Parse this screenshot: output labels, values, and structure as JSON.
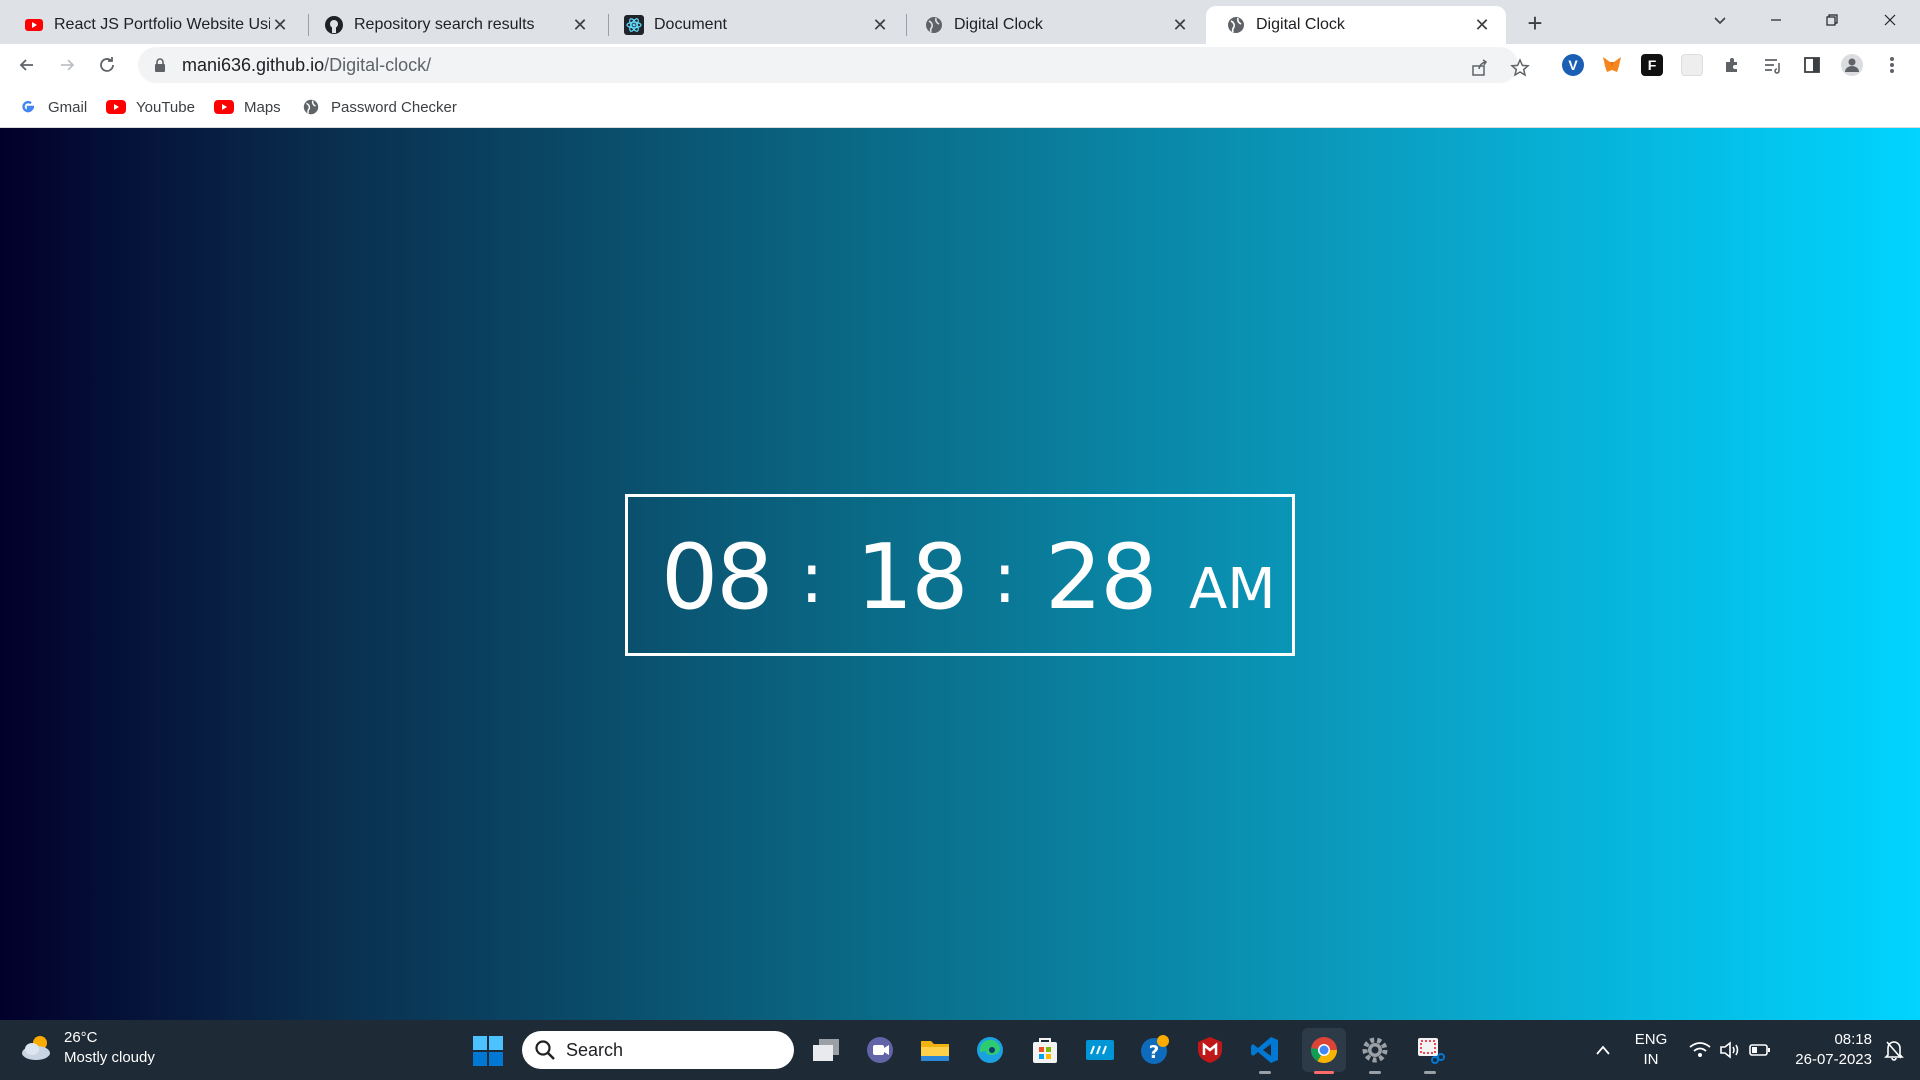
{
  "browser": {
    "tabs": [
      {
        "title": "React JS Portfolio Website Using",
        "favicon": "youtube-icon"
      },
      {
        "title": "Repository search results",
        "favicon": "github-icon"
      },
      {
        "title": "Document",
        "favicon": "react-icon"
      },
      {
        "title": "Digital Clock",
        "favicon": "globe-icon"
      },
      {
        "title": "Digital Clock",
        "favicon": "globe-icon",
        "active": true
      }
    ],
    "url_host": "mani636.github.io",
    "url_path": "/Digital-clock/",
    "bookmarks": [
      {
        "label": "Gmail",
        "icon": "google-icon"
      },
      {
        "label": "YouTube",
        "icon": "youtube-icon"
      },
      {
        "label": "Maps",
        "icon": "youtube-icon"
      },
      {
        "label": "Password Checker",
        "icon": "globe-icon"
      }
    ],
    "extensions": [
      "vpn-icon",
      "metamask-icon",
      "f-extension-icon",
      "blank-extension-icon",
      "puzzle-icon",
      "reading-list-icon",
      "side-panel-icon",
      "profile-icon",
      "menu-icon"
    ]
  },
  "clock": {
    "hours": "08",
    "sep1": ":",
    "minutes": "18",
    "sep2": ":",
    "seconds": "28",
    "ampm": "AM"
  },
  "taskbar": {
    "weather_temp": "26°C",
    "weather_desc": "Mostly cloudy",
    "search_label": "Search",
    "lang_line1": "ENG",
    "lang_line2": "IN",
    "time": "08:18",
    "date": "26-07-2023"
  },
  "colors": {
    "gradient_start": "#02002b",
    "gradient_end": "#00d4ff",
    "taskbar": "#1e2a35"
  }
}
